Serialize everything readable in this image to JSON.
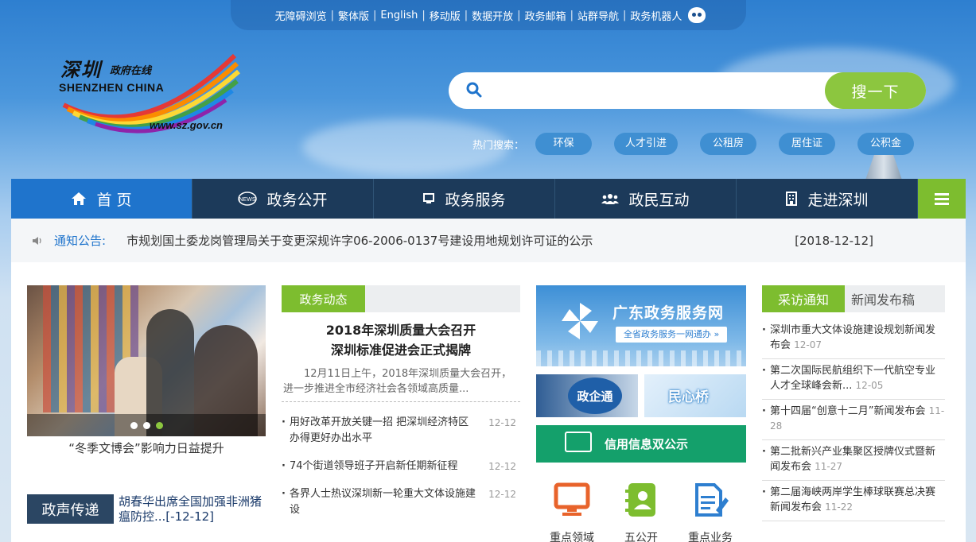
{
  "toplinks": [
    "无障碍浏览",
    "繁体版",
    "English",
    "移动版",
    "数据开放",
    "政务邮箱",
    "站群导航",
    "政务机器人"
  ],
  "logo": {
    "cn": "深圳",
    "cn2": "政府在线",
    "en": "SHENZHEN CHINA",
    "url": "www.sz.gov.cn"
  },
  "search": {
    "placeholder": "",
    "value": "",
    "button": "搜一下"
  },
  "hot": {
    "label": "热门搜索：",
    "tags": [
      "环保",
      "人才引进",
      "公租房",
      "居住证",
      "公积金"
    ]
  },
  "nav": {
    "home": "首 页",
    "items": [
      "政务公开",
      "政务服务",
      "政民互动",
      "走进深圳"
    ]
  },
  "notice": {
    "label": "通知公告:",
    "text": "市规划国土委龙岗管理局关于变更深规许字06-2006-0137号建设用地规划许可证的公示",
    "date": "[2018-12-12]"
  },
  "slider": {
    "caption": "“冬季文博会”影响力日益提升"
  },
  "voice": {
    "tag": "政声传递",
    "text": "胡春华出席全国加强非洲猪瘟防控...[-12-12]"
  },
  "news": {
    "tab": "政务动态",
    "headline_1": "2018年深圳质量大会召开",
    "headline_2": "深圳标准促进会正式揭牌",
    "summary": "12月11日上午，2018年深圳质量大会召开，进一步推进全市经济社会各领域高质量...",
    "items": [
      {
        "title": "用好改革开放关键一招 把深圳经济特区办得更好办出水平",
        "date": "12-12"
      },
      {
        "title": "74个街道领导班子开启新任期新征程",
        "date": "12-12"
      },
      {
        "title": "各界人士热议深圳新一轮重大文体设施建设",
        "date": "12-12"
      }
    ]
  },
  "services": {
    "gd_title": "广东政务服务网",
    "gd_sub": "全省政务服务一网通办 »",
    "zqt": "政企通",
    "mxq": "民心桥",
    "xyxx": "信用信息双公示",
    "icons": [
      "重点领域",
      "五公开",
      "重点业务"
    ]
  },
  "interviews": {
    "tab_active": "采访通知",
    "tab_other": "新闻发布稿",
    "items": [
      {
        "title": "深圳市重大文体设施建设规划新闻发布会",
        "date": "12-07"
      },
      {
        "title": "第二次国际民航组织下一代航空专业人才全球峰会新...",
        "date": "12-05"
      },
      {
        "title": "第十四届“创意十二月”新闻发布会",
        "date": "11-28"
      },
      {
        "title": "第二批新兴产业集聚区授牌仪式暨新闻发布会",
        "date": "11-27"
      },
      {
        "title": "第二届海峡两岸学生棒球联赛总决赛新闻发布会",
        "date": "11-22"
      }
    ]
  },
  "colors": {
    "accent_green": "#7dbd2f",
    "nav_dark": "#1c3a5a",
    "nav_active": "#1f74cc",
    "link_blue": "#1f74cc"
  }
}
